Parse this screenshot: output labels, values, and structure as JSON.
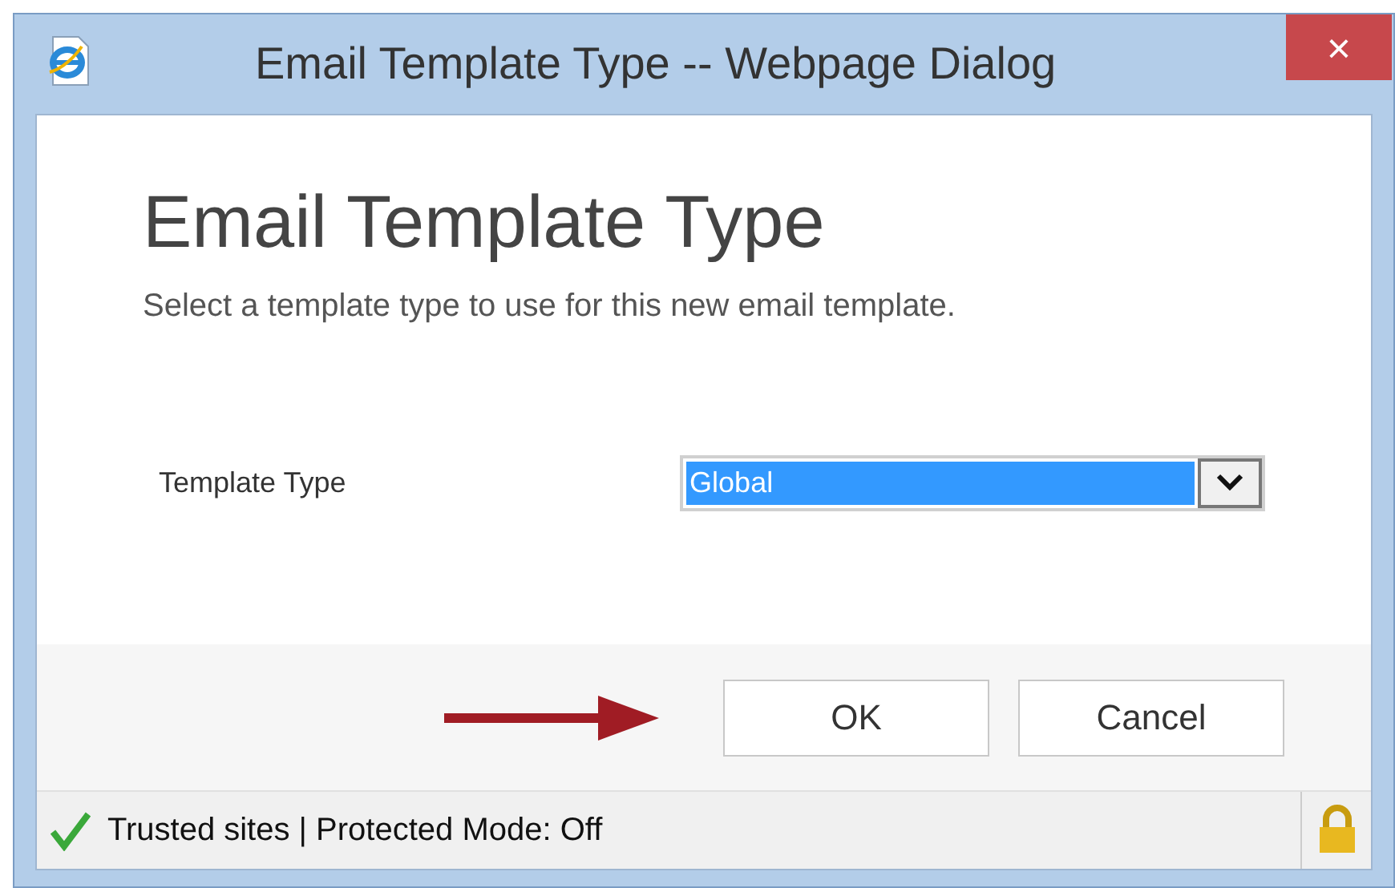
{
  "window": {
    "title": "Email Template Type -- Webpage Dialog",
    "close": "×"
  },
  "heading": "Email Template Type",
  "description": "Select a template type to use for this new email template.",
  "field": {
    "label": "Template Type",
    "value": "Global",
    "selected": true
  },
  "buttons": [
    {
      "label": "OK"
    },
    {
      "label": "Cancel"
    }
  ],
  "status_bar": {
    "text": "Trusted sites | Protected Mode: Off"
  }
}
